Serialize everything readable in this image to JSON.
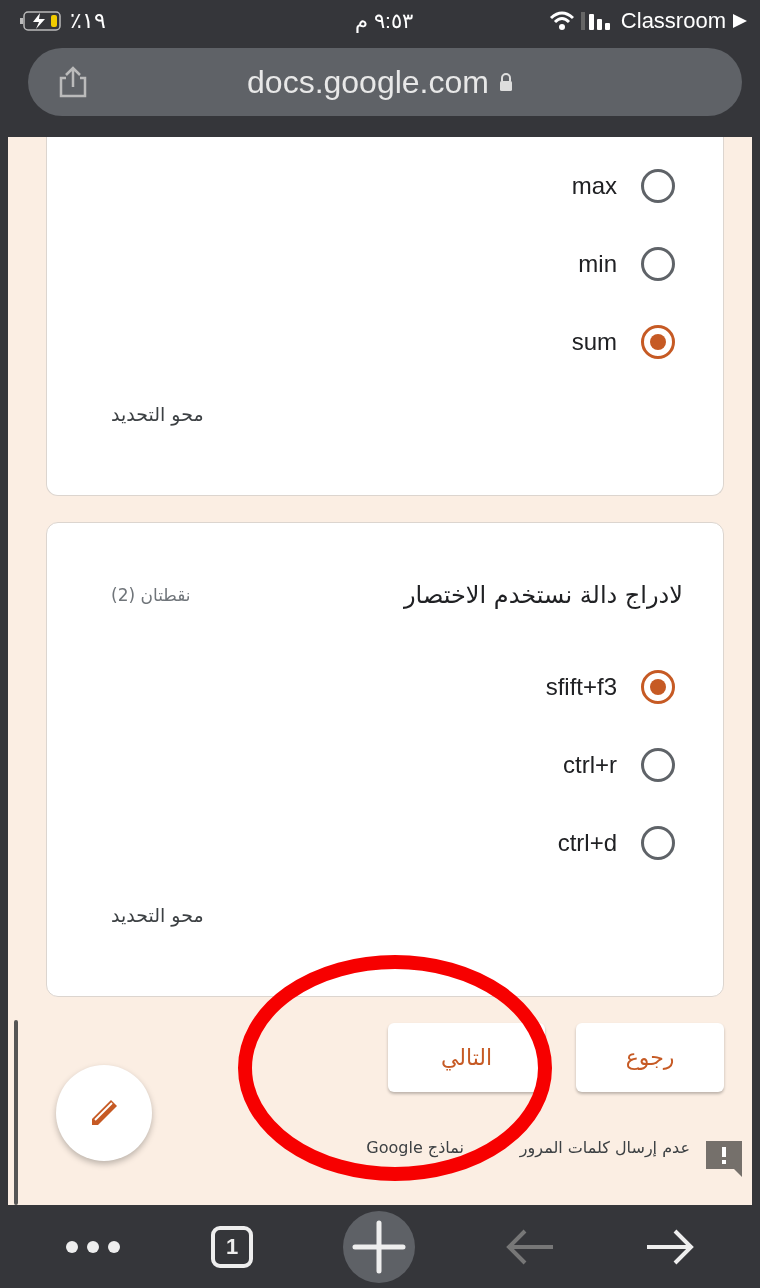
{
  "status_bar": {
    "battery": "٪١٩",
    "time": "٩:٥٣ م",
    "carrier": "Classroom"
  },
  "address_bar": {
    "url": "docs.google.com"
  },
  "questions": [
    {
      "options": [
        {
          "label": "max",
          "selected": false
        },
        {
          "label": "min",
          "selected": false
        },
        {
          "label": "sum",
          "selected": true
        }
      ],
      "clear": "محو التحديد"
    },
    {
      "title": "لادراج دالة نستخدم الاختصار",
      "points": "نقطتان (2)",
      "options": [
        {
          "label": "sfift+f3",
          "selected": true
        },
        {
          "label": "ctrl+r",
          "selected": false
        },
        {
          "label": "ctrl+d",
          "selected": false
        }
      ],
      "clear": "محو التحديد"
    }
  ],
  "nav_buttons": [
    {
      "label": "رجوع"
    },
    {
      "label": "التالي"
    }
  ],
  "footer": {
    "parts": [
      "عدم إرسال كلمات المرور",
      "نماذج Google"
    ]
  },
  "toolbar": {
    "tab_count": "1"
  }
}
